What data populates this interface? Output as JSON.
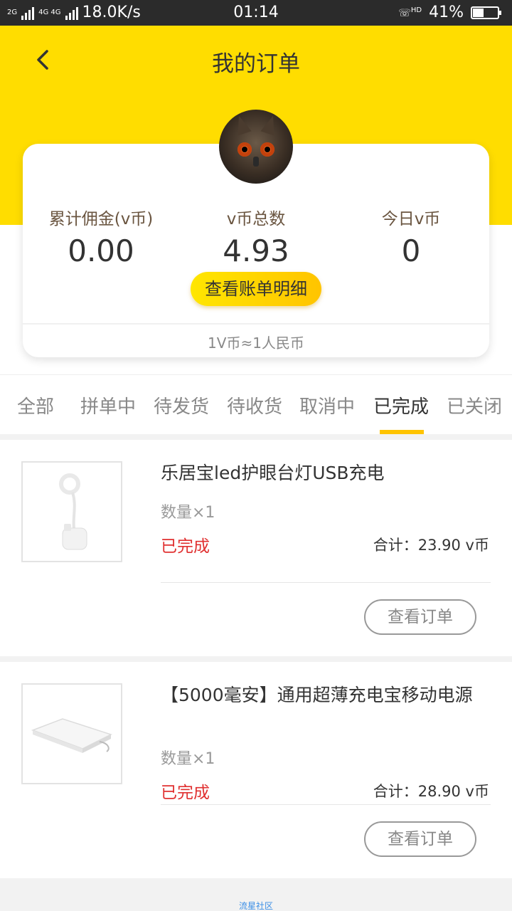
{
  "status_bar": {
    "network_2g": "2G",
    "network_4g": "4G 4G",
    "speed": "18.0K/s",
    "time": "01:14",
    "hd": "HD",
    "battery": "41%"
  },
  "header": {
    "title": "我的订单"
  },
  "stats": {
    "commission_label": "累计佣金(v币)",
    "commission_value": "0.00",
    "total_label": "v币总数",
    "total_value": "4.93",
    "today_label": "今日v币",
    "today_value": "0"
  },
  "bill_button_label": "查看账单明细",
  "rate_note": "1V币≈1人民币",
  "tabs": [
    {
      "label": "全部"
    },
    {
      "label": "拼单中"
    },
    {
      "label": "待发货"
    },
    {
      "label": "待收货"
    },
    {
      "label": "取消中"
    },
    {
      "label": "已完成"
    },
    {
      "label": "已关闭"
    }
  ],
  "orders": [
    {
      "title": "乐居宝led护眼台灯USB充电",
      "qty": "数量×1",
      "status": "已完成",
      "total": "合计：23.90 v币",
      "button": "查看订单"
    },
    {
      "title": "【5000毫安】通用超薄充电宝移动电源",
      "qty": "数量×1",
      "status": "已完成",
      "total": "合计：28.90 v币",
      "button": "查看订单"
    }
  ],
  "footer": "流星社区"
}
